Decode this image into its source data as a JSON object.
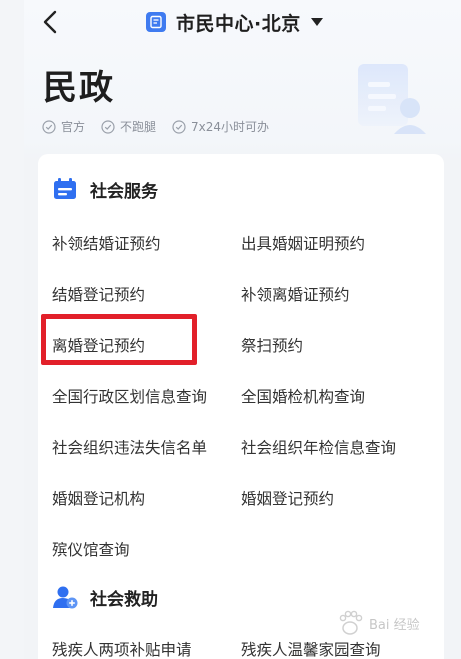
{
  "header": {
    "title": "市民中心·北京"
  },
  "page": {
    "heading": "民政",
    "badges": [
      "官方",
      "不跑腿",
      "7x24小时可办"
    ]
  },
  "sections": [
    {
      "title": "社会服务",
      "items": [
        "补领结婚证预约",
        "出具婚姻证明预约",
        "结婚登记预约",
        "补领离婚证预约",
        "离婚登记预约",
        "祭扫预约",
        "全国行政区划信息查询",
        "全国婚检机构查询",
        "社会组织违法失信名单",
        "社会组织年检信息查询",
        "婚姻登记机构",
        "婚姻登记预约",
        "殡仪馆查询"
      ]
    },
    {
      "title": "社会救助",
      "items": [
        "残疾人两项补贴申请",
        "残疾人温馨家园查询"
      ]
    }
  ],
  "highlighted_item": "离婚登记预约",
  "colors": {
    "accent": "#3f7bf0",
    "highlight_border": "#e2202a",
    "icon_blue": "#2f6ff0"
  },
  "watermark": {
    "text": "Bai 经验"
  }
}
